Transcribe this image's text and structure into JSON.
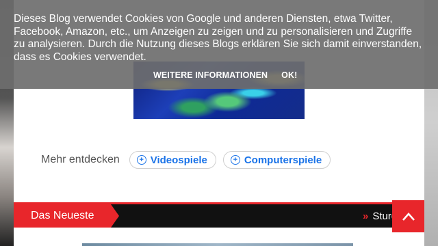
{
  "cookie_banner": {
    "text": "Dieses Blog verwendet Cookies von Google und anderen Diensten, etwa Twitter, Facebook, Amazon, etc., um Anzeigen zu zeigen und zu personalisieren und Zugriffe zu analysieren. Durch die Nutzung dieses Blogs erklären Sie sich damit einverstanden, dass es Cookies verwendet.",
    "more_info_label": "Weitere Informationen",
    "ok_label": "OK!"
  },
  "discover": {
    "label": "Mehr entdecken",
    "pills": [
      {
        "label": "Videospiele",
        "icon": "plus-circle-icon"
      },
      {
        "label": "Computerspiele",
        "icon": "plus-circle-icon"
      }
    ]
  },
  "ticker": {
    "title": "Das Neueste",
    "item": "Sturg"
  },
  "colors": {
    "accent": "#e8262b",
    "link": "#1a73e8",
    "banner": "#6e6e6e"
  }
}
